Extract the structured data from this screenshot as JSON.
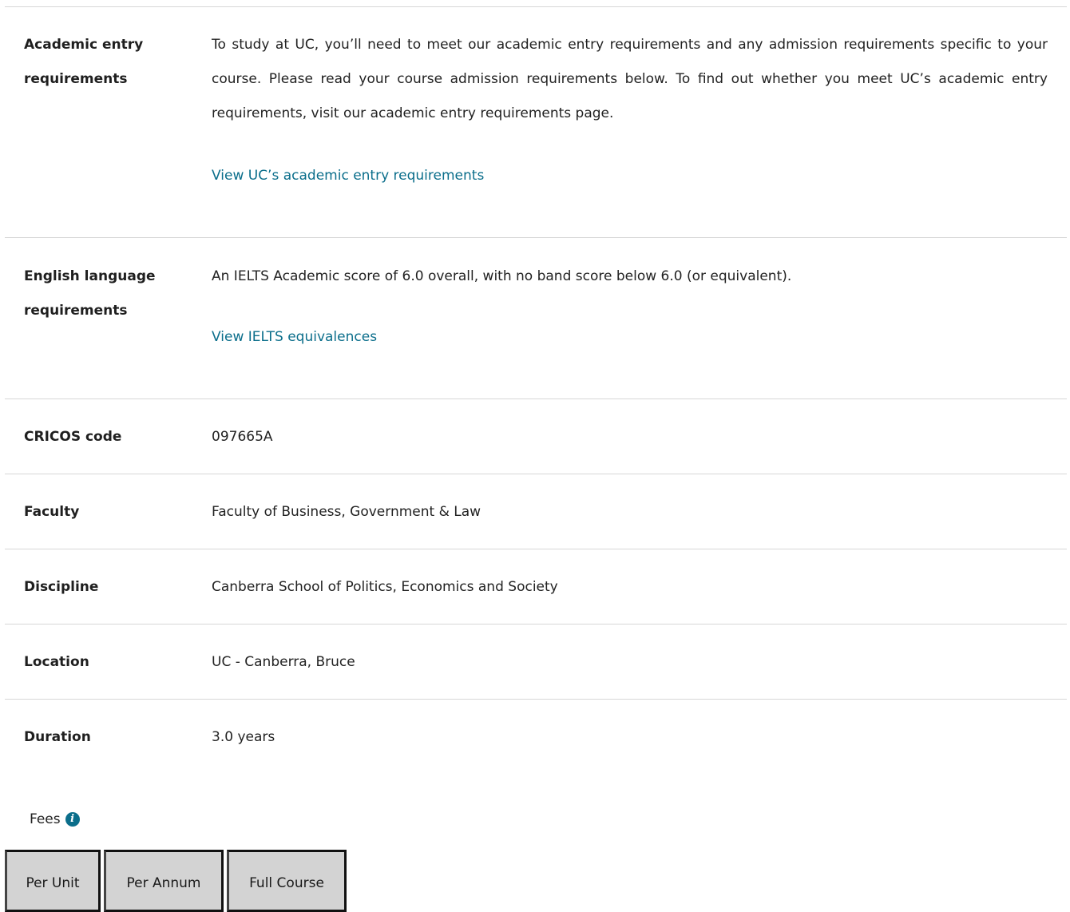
{
  "rows": [
    {
      "label_line1": "Academic entry",
      "label_line2": "requirements",
      "value": "To study at UC, you’ll need to meet our academic entry requirements and any admission requirements specific to your course. Please read your course admission requirements below. To find out whether you meet UC’s academic entry requirements, visit our academic entry requirements page.",
      "link": "View UC’s academic entry requirements"
    },
    {
      "label_line1": "English language",
      "label_line2": "requirements",
      "value": "An IELTS Academic score of 6.0 overall, with no band score below 6.0 (or equivalent).",
      "link": "View IELTS equivalences"
    },
    {
      "label": "CRICOS code",
      "value": "097665A"
    },
    {
      "label": "Faculty",
      "value": "Faculty of Business, Government & Law"
    },
    {
      "label": "Discipline",
      "value": "Canberra School of Politics, Economics and Society"
    },
    {
      "label": "Location",
      "value": "UC - Canberra, Bruce"
    },
    {
      "label": "Duration",
      "value": "3.0 years"
    }
  ],
  "fees": {
    "title": "Fees",
    "info_icon": "info-circle-icon",
    "tabs": [
      "Per Unit",
      "Per Annum",
      "Full Course"
    ]
  },
  "colors": {
    "link": "#0b6e8b",
    "divider": "#d7d7d7",
    "tab_bg": "#d3d3d3"
  }
}
